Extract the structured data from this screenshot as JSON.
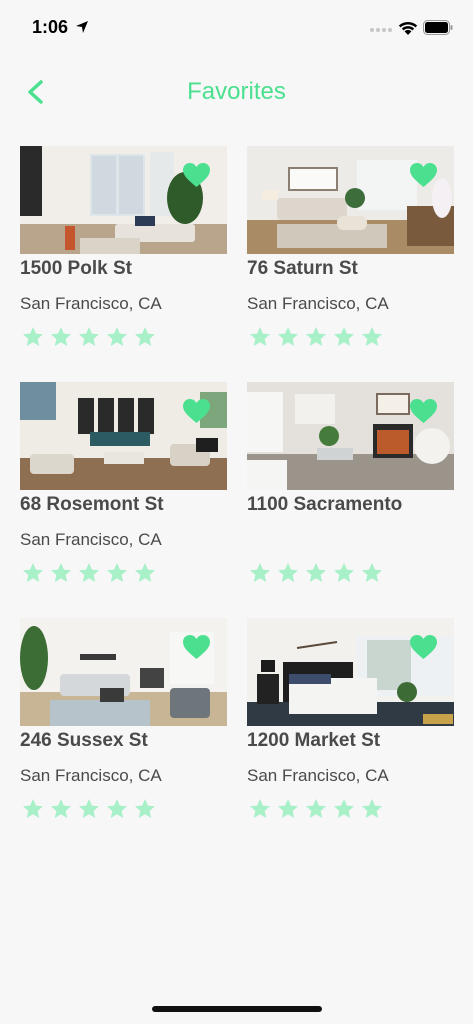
{
  "status_bar": {
    "time": "1:06"
  },
  "nav": {
    "title": "Favorites"
  },
  "colors": {
    "accent": "#4be08f",
    "star": "#a7f0c8",
    "text": "#4a4a4a"
  },
  "listings": [
    {
      "address": "1500 Polk St",
      "city": "San Francisco, CA",
      "stars": 5,
      "favorited": true
    },
    {
      "address": "76 Saturn St",
      "city": "San Francisco, CA",
      "stars": 5,
      "favorited": true
    },
    {
      "address": "68 Rosemont St",
      "city": "San Francisco, CA",
      "stars": 5,
      "favorited": true
    },
    {
      "address": "1100 Sacramento",
      "city": "",
      "stars": 5,
      "favorited": true
    },
    {
      "address": "246 Sussex St",
      "city": "San Francisco, CA",
      "stars": 5,
      "favorited": true
    },
    {
      "address": "1200 Market St",
      "city": "San Francisco, CA",
      "stars": 5,
      "favorited": true
    }
  ]
}
